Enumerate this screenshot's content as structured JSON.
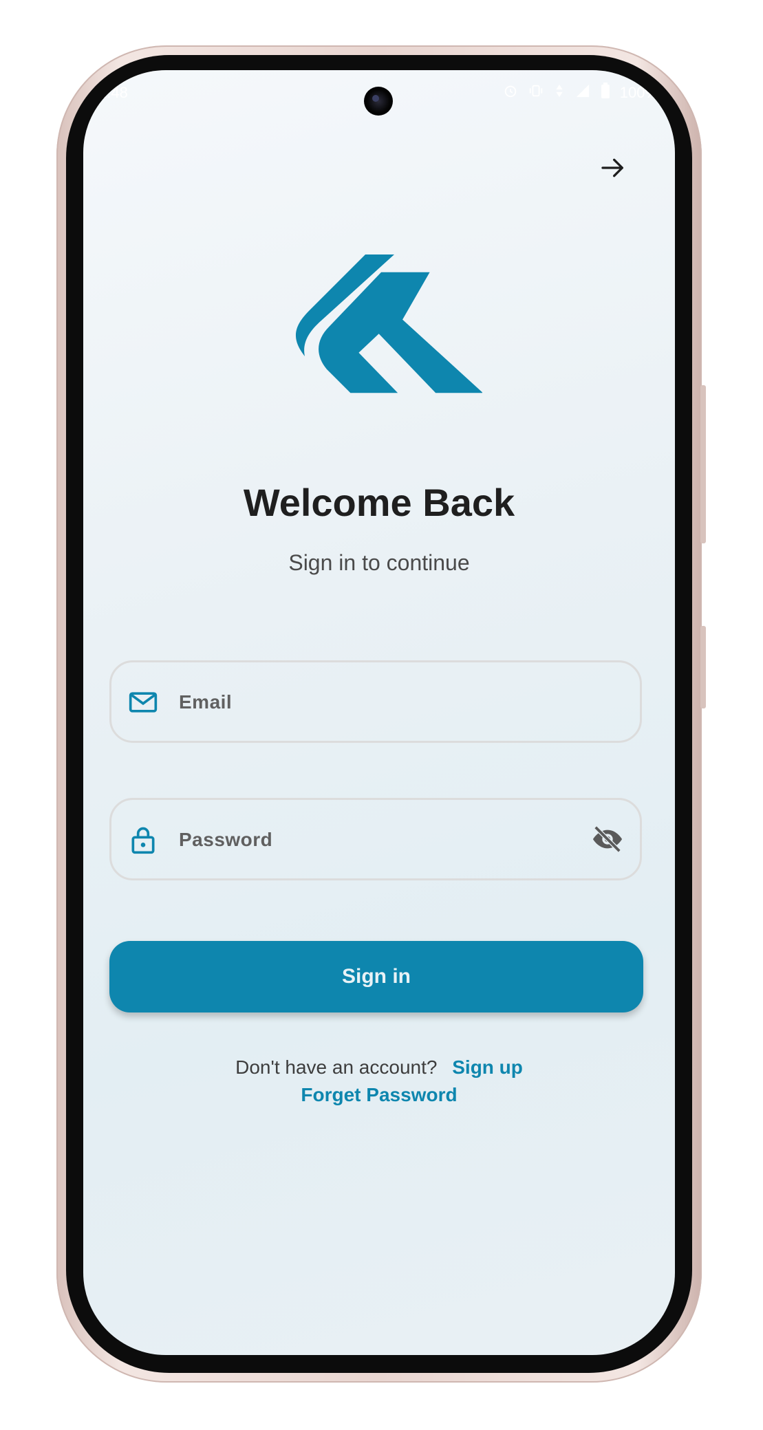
{
  "status_bar": {
    "time": "1:48",
    "battery": "100%",
    "icons": [
      "alarm-icon",
      "vibrate-icon",
      "data-icon",
      "signal-icon",
      "battery-icon"
    ]
  },
  "header": {
    "skip_icon": "arrow-right-icon"
  },
  "brand": {
    "logo_icon": "double-chevron-logo",
    "logo_color": "#0e86ae"
  },
  "main": {
    "title": "Welcome Back",
    "subtitle": "Sign in to continue"
  },
  "form": {
    "email": {
      "placeholder": "Email",
      "value": "",
      "icon": "mail-icon"
    },
    "password": {
      "placeholder": "Password",
      "value": "",
      "icon": "lock-icon",
      "toggle_icon": "eye-off-icon"
    },
    "submit_label": "Sign in"
  },
  "footer": {
    "no_account_text": "Don't have an account?",
    "signup_label": "Sign up",
    "forget_label": "Forget Password"
  },
  "colors": {
    "accent": "#0e86ae",
    "title": "#1f1f1f",
    "field_border": "#dcdcdc"
  }
}
